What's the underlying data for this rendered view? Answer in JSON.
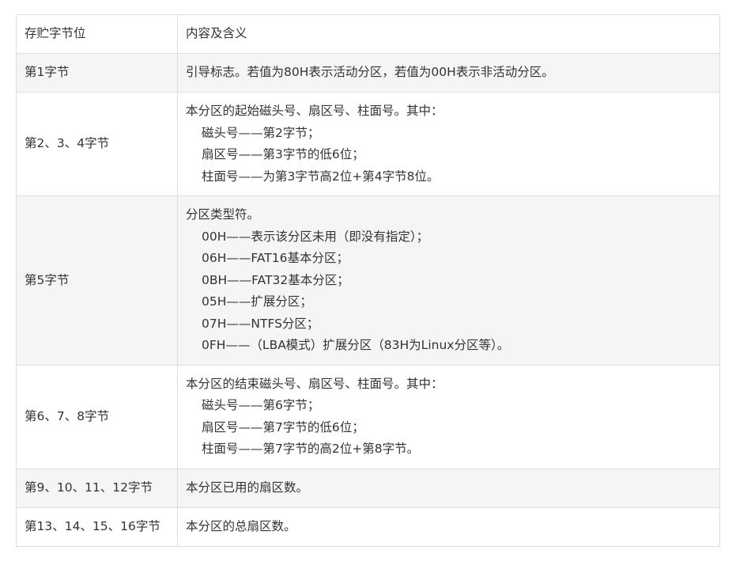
{
  "table": {
    "header": {
      "col1": "存贮字节位",
      "col2": "内容及含义"
    },
    "rows": [
      {
        "byte": "第1字节",
        "lines": [
          "引导标志。若值为80H表示活动分区，若值为00H表示非活动分区。"
        ]
      },
      {
        "byte": "第2、3、4字节",
        "lines": [
          "本分区的起始磁头号、扇区号、柱面号。其中：",
          "磁头号——第2字节；",
          "扇区号——第3字节的低6位；",
          "柱面号——为第3字节高2位+第4字节8位。"
        ]
      },
      {
        "byte": "第5字节",
        "lines": [
          "分区类型符。",
          "00H——表示该分区未用（即没有指定）；",
          "06H——FAT16基本分区；",
          "0BH——FAT32基本分区；",
          "05H——扩展分区；",
          "07H——NTFS分区；",
          "0FH——（LBA模式）扩展分区（83H为Linux分区等）。"
        ]
      },
      {
        "byte": "第6、7、8字节",
        "lines": [
          "本分区的结束磁头号、扇区号、柱面号。其中：",
          "磁头号——第6字节；",
          "扇区号——第7字节的低6位；",
          "柱面号——第7字节的高2位+第8字节。"
        ]
      },
      {
        "byte": "第9、10、11、12字节",
        "lines": [
          "本分区已用的扇区数。"
        ]
      },
      {
        "byte": "第13、14、15、16字节",
        "lines": [
          "本分区的总扇区数。"
        ]
      }
    ]
  }
}
